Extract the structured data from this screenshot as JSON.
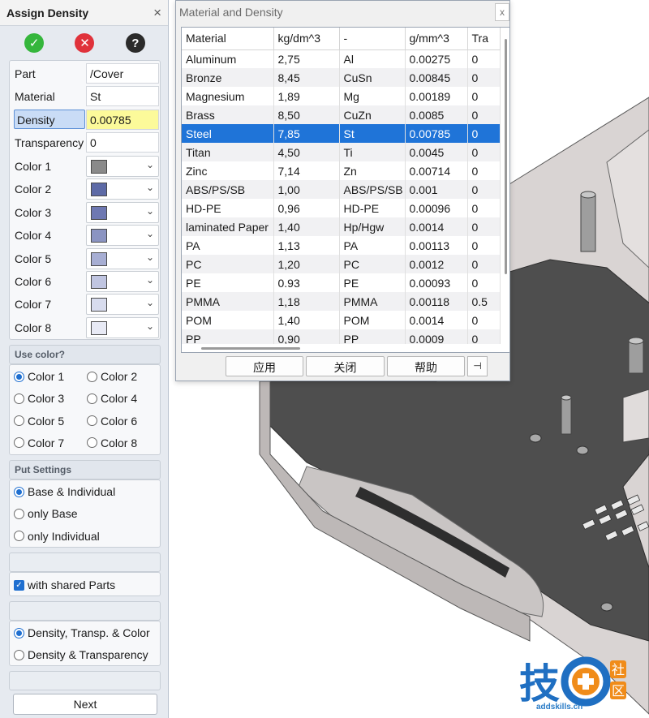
{
  "panel": {
    "title": "Assign Density",
    "close": "×",
    "toolbar": {
      "ok": "✓",
      "cancel": "✕",
      "help": "?"
    },
    "part_label": "Part",
    "part_value": "/Cover",
    "material_label": "Material",
    "material_value": "St",
    "density_label": "Density",
    "density_value": "0.00785",
    "transparency_label": "Transparency",
    "transparency_value": "0",
    "colors": [
      {
        "label": "Color 1",
        "swatch": "#8a8a8a"
      },
      {
        "label": "Color 2",
        "swatch": "#5d6aa6"
      },
      {
        "label": "Color 3",
        "swatch": "#6e78b2"
      },
      {
        "label": "Color 4",
        "swatch": "#8b94c2"
      },
      {
        "label": "Color 5",
        "swatch": "#a7aed3"
      },
      {
        "label": "Color 6",
        "swatch": "#c0c5e1"
      },
      {
        "label": "Color 7",
        "swatch": "#d8dcee"
      },
      {
        "label": "Color 8",
        "swatch": "#e8eaf5"
      }
    ],
    "use_color": {
      "title": "Use color?",
      "options": [
        "Color 1",
        "Color 2",
        "Color 3",
        "Color 4",
        "Color 5",
        "Color 6",
        "Color 7",
        "Color 8"
      ],
      "selected": "Color 1"
    },
    "put_settings": {
      "title": "Put Settings",
      "options": [
        "Base & Individual",
        "only Base",
        "only Individual"
      ],
      "selected": "Base & Individual"
    },
    "shared_parts": {
      "label": "with shared Parts",
      "checked": true
    },
    "mode": {
      "options": [
        "Density, Transp. & Color",
        "Density & Transparency"
      ],
      "selected": "Density, Transp. & Color"
    },
    "next_label": "Next"
  },
  "dialog": {
    "title": "Material and Density",
    "close": "x",
    "columns": [
      "Material",
      "kg/dm^3",
      "-",
      "g/mm^3",
      "Tra"
    ],
    "rows": [
      [
        "Aluminum",
        "2,75",
        "Al",
        "0.00275",
        "0"
      ],
      [
        "Bronze",
        "8,45",
        "CuSn",
        "0.00845",
        "0"
      ],
      [
        "Magnesium",
        "1,89",
        "Mg",
        "0.00189",
        "0"
      ],
      [
        "Brass",
        "8,50",
        "CuZn",
        "0.0085",
        "0"
      ],
      [
        "Steel",
        "7,85",
        "St",
        "0.00785",
        "0"
      ],
      [
        "Titan",
        "4,50",
        "Ti",
        "0.0045",
        "0"
      ],
      [
        "Zinc",
        "7,14",
        "Zn",
        "0.00714",
        "0"
      ],
      [
        "ABS/PS/SB",
        "1,00",
        "ABS/PS/SB",
        "0.001",
        "0"
      ],
      [
        "HD-PE",
        "0,96",
        "HD-PE",
        "0.00096",
        "0"
      ],
      [
        "laminated Paper",
        "1,40",
        "Hp/Hgw",
        "0.0014",
        "0"
      ],
      [
        "PA",
        "1,13",
        "PA",
        "0.00113",
        "0"
      ],
      [
        "PC",
        "1,20",
        "PC",
        "0.0012",
        "0"
      ],
      [
        "PE",
        "0.93",
        "PE",
        "0.00093",
        "0"
      ],
      [
        "PMMA",
        "1,18",
        "PMMA",
        "0.00118",
        "0.5"
      ],
      [
        "POM",
        "1,40",
        "POM",
        "0.0014",
        "0"
      ],
      [
        "PP",
        "0,90",
        "PP",
        "0.0009",
        "0"
      ]
    ],
    "selected_row": 4,
    "buttons": {
      "apply": "应用",
      "close": "关闭",
      "help": "帮助",
      "pin": "⊣"
    }
  },
  "logo": {
    "char1": "技",
    "char2": "社",
    "char3": "区",
    "url": "addskills.cn"
  }
}
